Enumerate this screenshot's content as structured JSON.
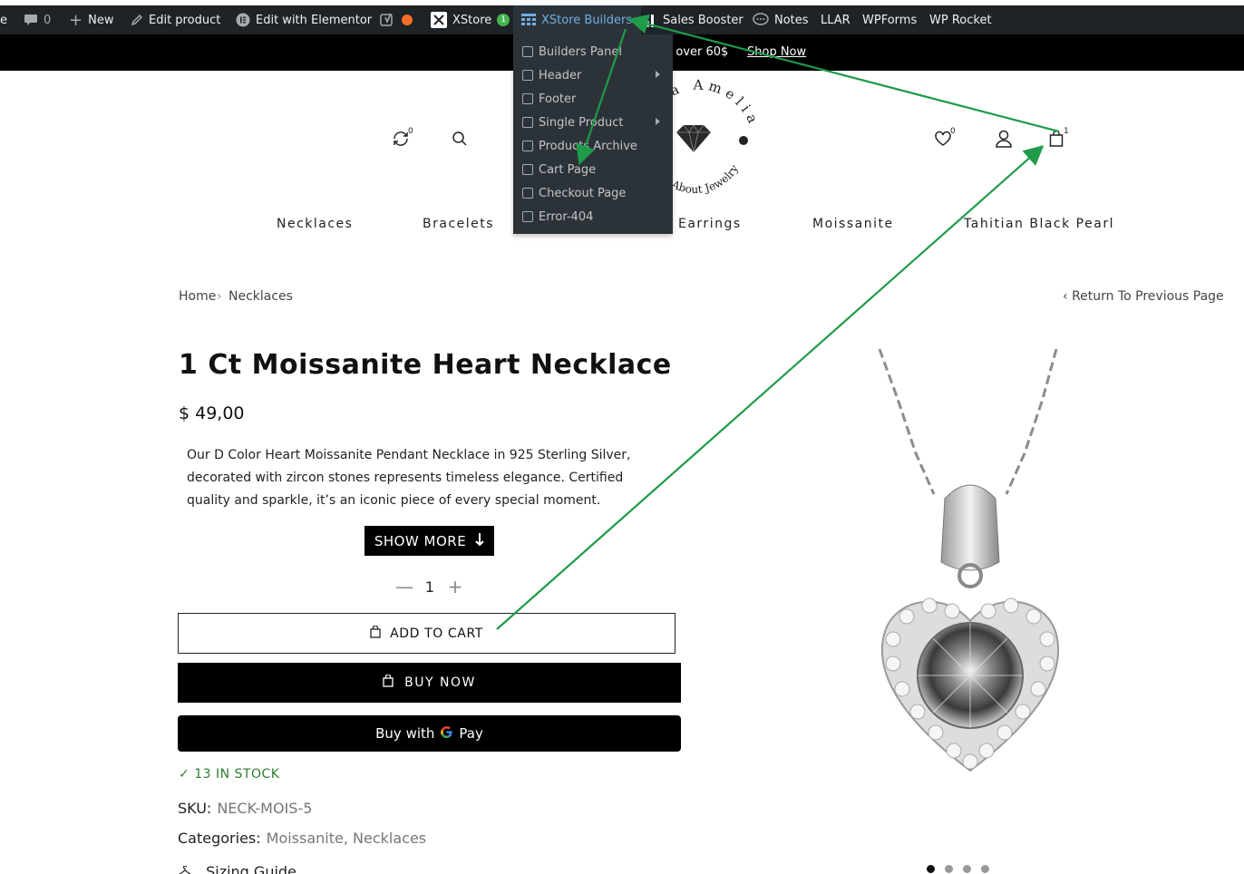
{
  "adminbar": {
    "site_partial": "e",
    "comments_count": "0",
    "new_label": "New",
    "edit_product_label": "Edit product",
    "elementor_label": "Edit with Elementor",
    "xstore_label": "XStore",
    "xstore_badge": "1",
    "builders_label": "XStore Builders",
    "sales_booster_label": "Sales Booster",
    "notes_label": "Notes",
    "llar_label": "LLAR",
    "wpforms_label": "WPForms",
    "wprocket_label": "WP Rocket"
  },
  "promo": {
    "text": "g over 60$",
    "link": "Shop Now"
  },
  "builders_menu": {
    "items": [
      {
        "label": "Builders Panel",
        "icon": "builder-panel-icon",
        "has_sub": false
      },
      {
        "label": "Header",
        "icon": "header-icon",
        "has_sub": true
      },
      {
        "label": "Footer",
        "icon": "footer-icon",
        "has_sub": false
      },
      {
        "label": "Single Product",
        "icon": "product-bag-icon",
        "has_sub": true
      },
      {
        "label": "Products Archive",
        "icon": "archive-icon",
        "has_sub": false
      },
      {
        "label": "Cart Page",
        "icon": "cart-icon",
        "has_sub": false
      },
      {
        "label": "Checkout Page",
        "icon": "checkout-cart-icon",
        "has_sub": false
      },
      {
        "label": "Error-404",
        "icon": "warning-icon",
        "has_sub": false
      }
    ]
  },
  "header": {
    "compare_count": "0",
    "wishlist_count": "0",
    "cart_count": "1",
    "logo_text_top": "a Amelia",
    "logo_text_bottom": "About Jewelry"
  },
  "nav": {
    "items": [
      "Necklaces",
      "Bracelets",
      "Earrings",
      "Moissanite",
      "Tahitian Black Pearl"
    ]
  },
  "breadcrumb": {
    "home": "Home",
    "separator": "›",
    "current": "Necklaces",
    "back": "Return To Previous Page"
  },
  "product": {
    "title": "1 Ct Moissanite Heart Necklace",
    "price": "$ 49,00",
    "description": "Our D Color Heart Moissanite Pendant Necklace in 925 Sterling Silver, decorated with zircon stones represents timeless elegance. Certified quality and sparkle, it’s an iconic piece of every special moment.",
    "show_more": "SHOW MORE",
    "quantity": "1",
    "add_to_cart": "ADD TO CART",
    "buy_now": "BUY NOW",
    "gpay_prefix": "Buy with",
    "gpay_brand": "Pay",
    "stock": "13 IN STOCK",
    "sku_label": "SKU:",
    "sku": "NECK-MOIS-5",
    "categories_label": "Categories:",
    "categories": "Moissanite, Necklaces",
    "sizing_guide": "Sizing Guide"
  },
  "gallery": {
    "slide_count": 4,
    "active_slide": 1
  },
  "colors": {
    "admin_bg": "#1d2327",
    "admin_active": "#2c3338",
    "admin_link_active": "#72aee6",
    "annotation_green": "#1f9b4a",
    "stock_green": "#2e7d32"
  }
}
